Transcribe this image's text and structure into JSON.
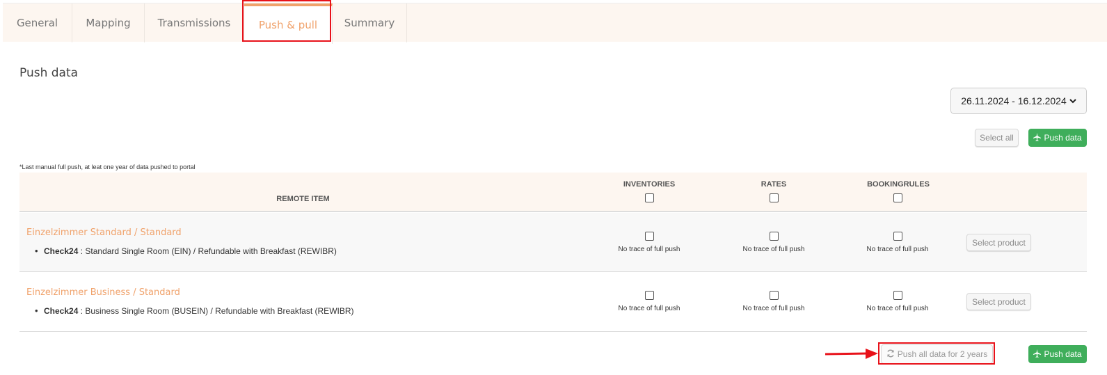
{
  "tabs": [
    {
      "label": "General"
    },
    {
      "label": "Mapping"
    },
    {
      "label": "Transmissions"
    },
    {
      "label": "Push & pull"
    },
    {
      "label": "Summary"
    }
  ],
  "section_title": "Push data",
  "date_range": {
    "value": "26.11.2024 - 16.12.2024",
    "icon": "chevron-down-icon"
  },
  "actions": {
    "select_all": "Select all",
    "push_data": "Push data",
    "push_all_years": "Push all data for 2 years"
  },
  "note": "*Last manual full push, at leat one year of data pushed to portal",
  "table": {
    "headers": {
      "remote_item": "REMOTE ITEM",
      "inventories": "INVENTORIES",
      "rates": "RATES",
      "bookingrules": "BOOKINGRULES"
    },
    "rows": [
      {
        "room": "Einzelzimmer Standard / Standard",
        "channel": "Check24",
        "detail": " : Standard Single Room (EIN) / Refundable with Breakfast (REWIBR)",
        "inventories_trace": "No trace of full push",
        "rates_trace": "No trace of full push",
        "bookingrules_trace": "No trace of full push",
        "select_product": "Select product"
      },
      {
        "room": "Einzelzimmer Business / Standard",
        "channel": "Check24",
        "detail": " : Business Single Room (BUSEIN) / Refundable with Breakfast (REWIBR)",
        "inventories_trace": "No trace of full push",
        "rates_trace": "No trace of full push",
        "bookingrules_trace": "No trace of full push",
        "select_product": "Select product"
      }
    ]
  },
  "colors": {
    "accent": "#f0a26b",
    "green": "#3fae5b",
    "highlight": "#e8121a",
    "tab_bg": "#fdf6f0"
  }
}
